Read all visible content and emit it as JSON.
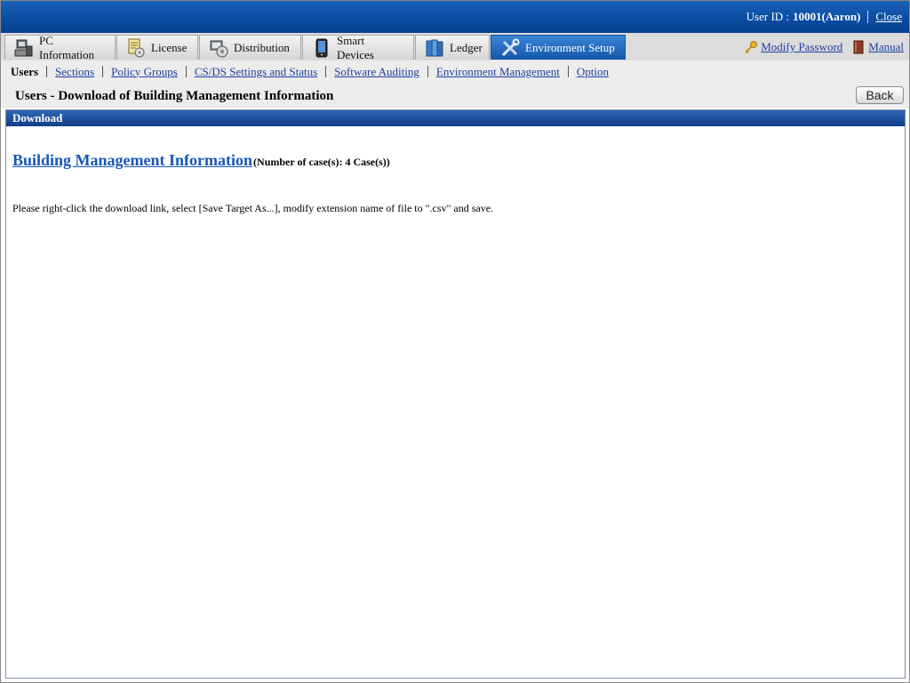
{
  "header": {
    "user_id_label": "User ID :",
    "user_id_value": "10001(Aaron)",
    "close_link": "Close"
  },
  "tabs": [
    {
      "label": "PC Information",
      "icon": "pc-icon"
    },
    {
      "label": "License",
      "icon": "license-icon"
    },
    {
      "label": "Distribution",
      "icon": "distribution-icon"
    },
    {
      "label": "Smart Devices",
      "icon": "smart-device-icon"
    },
    {
      "label": "Ledger",
      "icon": "ledger-icon"
    },
    {
      "label": "Environment Setup",
      "icon": "tools-icon",
      "active": true
    }
  ],
  "right_links": {
    "modify_password": "Modify Password",
    "manual": "Manual"
  },
  "subnav": {
    "current": "Users",
    "links": [
      "Sections",
      "Policy Groups",
      "CS/DS Settings and Status",
      "Software Auditing",
      "Environment Management",
      "Option"
    ]
  },
  "page": {
    "title": "Users - Download of Building Management Information",
    "back_button": "Back"
  },
  "panel": {
    "header": "Download",
    "download_link": "Building Management Information",
    "count_text": "(Number of case(s): 4 Case(s))",
    "note": "Please right-click the download link, select [Save Target As...], modify extension name of file to \".csv\" and save."
  },
  "colors": {
    "header_blue": "#0b4da3",
    "active_tab_blue": "#1557ac",
    "link_blue": "#1f3fa0"
  }
}
